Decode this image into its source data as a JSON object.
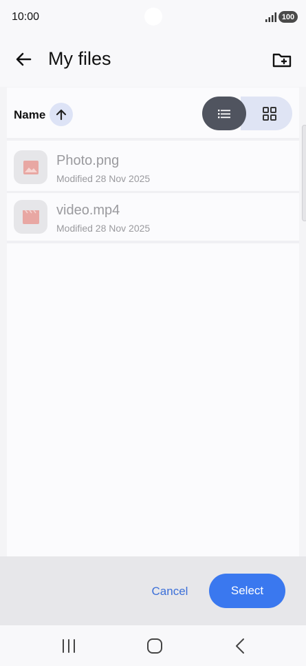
{
  "status_bar": {
    "time": "10:00",
    "battery": "100"
  },
  "app_bar": {
    "title": "My files"
  },
  "sort": {
    "label": "Name"
  },
  "files": [
    {
      "name": "Photo.png",
      "modified": "Modified 28 Nov 2025",
      "icon": "image-icon"
    },
    {
      "name": "video.mp4",
      "modified": "Modified 28 Nov 2025",
      "icon": "video-icon"
    }
  ],
  "actions": {
    "cancel_label": "Cancel",
    "select_label": "Select"
  },
  "colors": {
    "accent": "#3a78ef",
    "link": "#3b6fd8",
    "thumb_icon": "#e8a7a3"
  }
}
